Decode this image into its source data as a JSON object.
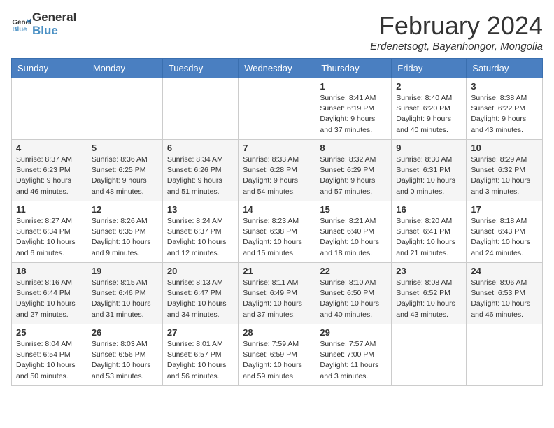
{
  "header": {
    "logo_line1": "General",
    "logo_line2": "Blue",
    "month_title": "February 2024",
    "location": "Erdenetsogt, Bayanhongor, Mongolia"
  },
  "weekdays": [
    "Sunday",
    "Monday",
    "Tuesday",
    "Wednesday",
    "Thursday",
    "Friday",
    "Saturday"
  ],
  "weeks": [
    [
      {
        "day": "",
        "info": ""
      },
      {
        "day": "",
        "info": ""
      },
      {
        "day": "",
        "info": ""
      },
      {
        "day": "",
        "info": ""
      },
      {
        "day": "1",
        "info": "Sunrise: 8:41 AM\nSunset: 6:19 PM\nDaylight: 9 hours and 37 minutes."
      },
      {
        "day": "2",
        "info": "Sunrise: 8:40 AM\nSunset: 6:20 PM\nDaylight: 9 hours and 40 minutes."
      },
      {
        "day": "3",
        "info": "Sunrise: 8:38 AM\nSunset: 6:22 PM\nDaylight: 9 hours and 43 minutes."
      }
    ],
    [
      {
        "day": "4",
        "info": "Sunrise: 8:37 AM\nSunset: 6:23 PM\nDaylight: 9 hours and 46 minutes."
      },
      {
        "day": "5",
        "info": "Sunrise: 8:36 AM\nSunset: 6:25 PM\nDaylight: 9 hours and 48 minutes."
      },
      {
        "day": "6",
        "info": "Sunrise: 8:34 AM\nSunset: 6:26 PM\nDaylight: 9 hours and 51 minutes."
      },
      {
        "day": "7",
        "info": "Sunrise: 8:33 AM\nSunset: 6:28 PM\nDaylight: 9 hours and 54 minutes."
      },
      {
        "day": "8",
        "info": "Sunrise: 8:32 AM\nSunset: 6:29 PM\nDaylight: 9 hours and 57 minutes."
      },
      {
        "day": "9",
        "info": "Sunrise: 8:30 AM\nSunset: 6:31 PM\nDaylight: 10 hours and 0 minutes."
      },
      {
        "day": "10",
        "info": "Sunrise: 8:29 AM\nSunset: 6:32 PM\nDaylight: 10 hours and 3 minutes."
      }
    ],
    [
      {
        "day": "11",
        "info": "Sunrise: 8:27 AM\nSunset: 6:34 PM\nDaylight: 10 hours and 6 minutes."
      },
      {
        "day": "12",
        "info": "Sunrise: 8:26 AM\nSunset: 6:35 PM\nDaylight: 10 hours and 9 minutes."
      },
      {
        "day": "13",
        "info": "Sunrise: 8:24 AM\nSunset: 6:37 PM\nDaylight: 10 hours and 12 minutes."
      },
      {
        "day": "14",
        "info": "Sunrise: 8:23 AM\nSunset: 6:38 PM\nDaylight: 10 hours and 15 minutes."
      },
      {
        "day": "15",
        "info": "Sunrise: 8:21 AM\nSunset: 6:40 PM\nDaylight: 10 hours and 18 minutes."
      },
      {
        "day": "16",
        "info": "Sunrise: 8:20 AM\nSunset: 6:41 PM\nDaylight: 10 hours and 21 minutes."
      },
      {
        "day": "17",
        "info": "Sunrise: 8:18 AM\nSunset: 6:43 PM\nDaylight: 10 hours and 24 minutes."
      }
    ],
    [
      {
        "day": "18",
        "info": "Sunrise: 8:16 AM\nSunset: 6:44 PM\nDaylight: 10 hours and 27 minutes."
      },
      {
        "day": "19",
        "info": "Sunrise: 8:15 AM\nSunset: 6:46 PM\nDaylight: 10 hours and 31 minutes."
      },
      {
        "day": "20",
        "info": "Sunrise: 8:13 AM\nSunset: 6:47 PM\nDaylight: 10 hours and 34 minutes."
      },
      {
        "day": "21",
        "info": "Sunrise: 8:11 AM\nSunset: 6:49 PM\nDaylight: 10 hours and 37 minutes."
      },
      {
        "day": "22",
        "info": "Sunrise: 8:10 AM\nSunset: 6:50 PM\nDaylight: 10 hours and 40 minutes."
      },
      {
        "day": "23",
        "info": "Sunrise: 8:08 AM\nSunset: 6:52 PM\nDaylight: 10 hours and 43 minutes."
      },
      {
        "day": "24",
        "info": "Sunrise: 8:06 AM\nSunset: 6:53 PM\nDaylight: 10 hours and 46 minutes."
      }
    ],
    [
      {
        "day": "25",
        "info": "Sunrise: 8:04 AM\nSunset: 6:54 PM\nDaylight: 10 hours and 50 minutes."
      },
      {
        "day": "26",
        "info": "Sunrise: 8:03 AM\nSunset: 6:56 PM\nDaylight: 10 hours and 53 minutes."
      },
      {
        "day": "27",
        "info": "Sunrise: 8:01 AM\nSunset: 6:57 PM\nDaylight: 10 hours and 56 minutes."
      },
      {
        "day": "28",
        "info": "Sunrise: 7:59 AM\nSunset: 6:59 PM\nDaylight: 10 hours and 59 minutes."
      },
      {
        "day": "29",
        "info": "Sunrise: 7:57 AM\nSunset: 7:00 PM\nDaylight: 11 hours and 3 minutes."
      },
      {
        "day": "",
        "info": ""
      },
      {
        "day": "",
        "info": ""
      }
    ]
  ]
}
